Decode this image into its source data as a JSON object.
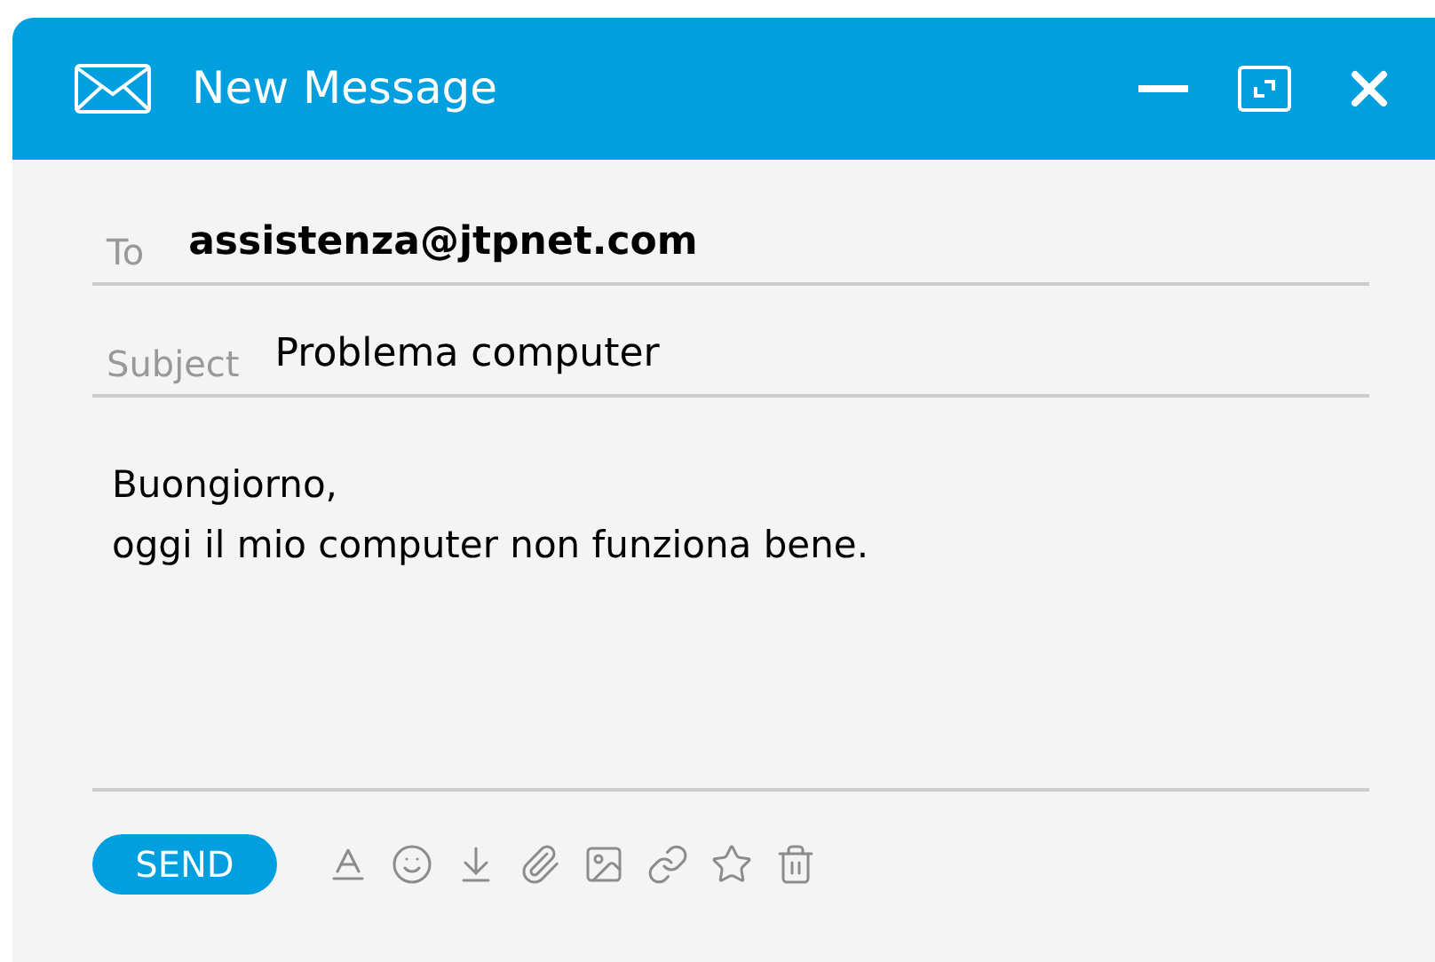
{
  "window": {
    "title": "New Message"
  },
  "to": {
    "label": "To",
    "value": "assistenza@jtpnet.com"
  },
  "subject": {
    "label": "Subject",
    "value": "Problema computer"
  },
  "body": [
    "Buongiorno,",
    "oggi il mio computer non funziona bene."
  ],
  "send_button": "SEND"
}
